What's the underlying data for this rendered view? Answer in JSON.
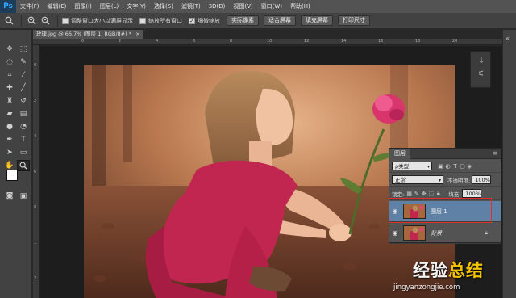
{
  "app": {
    "logo": "Ps"
  },
  "menu": [
    "文件(F)",
    "编辑(E)",
    "图像(I)",
    "图层(L)",
    "文字(Y)",
    "选择(S)",
    "滤镜(T)",
    "3D(D)",
    "视图(V)",
    "窗口(W)",
    "帮助(H)"
  ],
  "options": {
    "check_resize_window": "调整窗口大小以满屏显示",
    "check_zoom_all": "缩放所有窗口",
    "check_scrubby_zoom": "细微缩放",
    "btn_actual_pixels": "实际像素",
    "btn_fit_screen": "适合屏幕",
    "btn_fill_screen": "填充屏幕",
    "btn_print_size": "打印尺寸"
  },
  "document": {
    "tab_title": "玫瑰.jpg @ 66.7% (图层 1, RGB/8#) *",
    "close": "×"
  },
  "ruler_top": [
    "0",
    "2",
    "4",
    "6",
    "8",
    "10",
    "12",
    "14",
    "16",
    "18",
    "20"
  ],
  "ruler_left": [
    "0",
    "2",
    "4",
    "6",
    "8",
    "1",
    "2"
  ],
  "layers_panel": {
    "title": "图层",
    "filter_kind": "ρ类型",
    "blend_mode": "正常",
    "opacity_label": "不透明度:",
    "opacity_value": "100%",
    "lock_label": "锁定:",
    "fill_label": "填充:",
    "fill_value": "100%",
    "layers": [
      {
        "name": "图层 1",
        "selected": true
      },
      {
        "name": "背景",
        "selected": false
      }
    ]
  },
  "watermark": {
    "title_part1": "经验",
    "title_part2": "总结",
    "url": "jingyanzongjie.com"
  },
  "colors": {
    "highlight": "#e0302a",
    "selected_layer": "#5f81a6",
    "watermark_accent": "#f4c300"
  }
}
